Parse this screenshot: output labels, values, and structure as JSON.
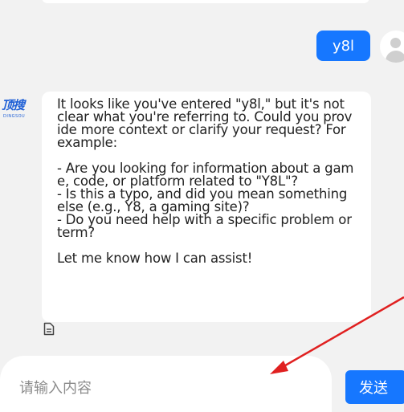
{
  "conversation": {
    "user_message": "y8l",
    "bot_logo_text": "顶搜",
    "bot_logo_subtext": "DINGSOU",
    "bot_message": "It looks like you've entered \"y8l,\" but it's not clear what you're referring to. Could you provide more context or clarify your request? For example:\n\n- Are you looking for information about a game, code, or platform related to \"Y8L\"?\n- Is this a typo, and did you mean something else (e.g., Y8, a gaming site)?\n- Do you need help with a specific problem or term?\n\nLet me know how I can assist!"
  },
  "input": {
    "placeholder": "请输入内容",
    "value": ""
  },
  "send_button": {
    "label": "发送"
  },
  "icons": {
    "user_avatar": "user-avatar-icon",
    "document": "document-icon",
    "annotation": "red-arrow"
  },
  "colors": {
    "accent": "#1677ff",
    "background": "#f2f2f2",
    "annotation": "#e02020"
  }
}
